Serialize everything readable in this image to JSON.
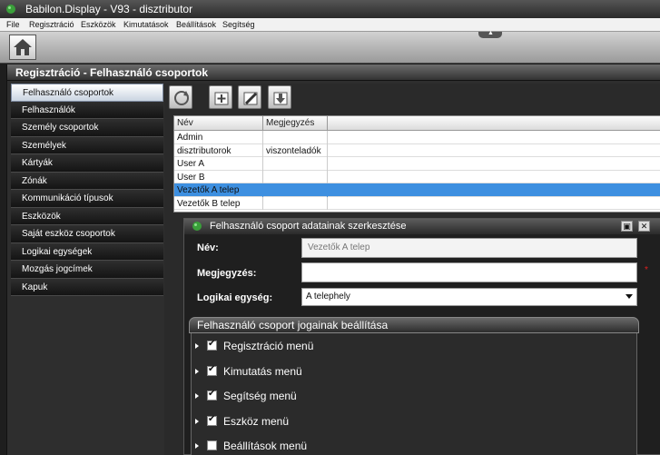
{
  "window": {
    "title": "Babilon.Display - V93 - disztributor"
  },
  "menu": {
    "items": [
      "File",
      "Regisztráció",
      "Eszközök",
      "Kimutatások",
      "Beállítások",
      "Segítség"
    ]
  },
  "page": {
    "header": "Regisztráció - Felhasználó csoportok"
  },
  "sidebar": {
    "items": [
      {
        "label": "Felhasználó csoportok",
        "active": true
      },
      {
        "label": "Felhasználók"
      },
      {
        "label": "Személy csoportok"
      },
      {
        "label": "Személyek"
      },
      {
        "label": "Kártyák"
      },
      {
        "label": "Zónák"
      },
      {
        "label": "Kommunikáció típusok"
      },
      {
        "label": "Eszközök"
      },
      {
        "label": "Saját eszköz csoportok"
      },
      {
        "label": "Logikai egységek"
      },
      {
        "label": "Mozgás jogcímek"
      },
      {
        "label": "Kapuk"
      }
    ]
  },
  "toolbar": {
    "buttons": [
      "refresh-icon",
      "add-icon",
      "edit-icon",
      "delete-icon"
    ]
  },
  "grid": {
    "columns": [
      "Név",
      "Megjegyzés"
    ],
    "rows": [
      {
        "name": "Admin",
        "note": ""
      },
      {
        "name": "disztributorok",
        "note": "viszonteladók"
      },
      {
        "name": "User A",
        "note": ""
      },
      {
        "name": "User B",
        "note": ""
      },
      {
        "name": "Vezetők A telep",
        "note": "",
        "selected": true
      },
      {
        "name": "Vezetők B telep",
        "note": ""
      }
    ]
  },
  "dialog": {
    "title": "Felhasználó csoport adatainak szerkesztése",
    "name_label": "Név:",
    "name_value": "Vezetők A telep",
    "note_label": "Megjegyzés:",
    "note_value": "",
    "required_mark": "*",
    "unit_label": "Logikai egység:",
    "unit_value": "A telephely",
    "permissions": {
      "title": "Felhasználó csoport jogainak beállítása",
      "items": [
        {
          "label": "Regisztráció menü",
          "checked": true
        },
        {
          "label": "Kimutatás menü",
          "checked": true
        },
        {
          "label": "Segítség menü",
          "checked": true
        },
        {
          "label": "Eszköz menü",
          "checked": true
        },
        {
          "label": "Beállítások menü",
          "checked": false
        }
      ]
    }
  },
  "colors": {
    "selection": "#3d8fe0",
    "required": "#e02020"
  }
}
